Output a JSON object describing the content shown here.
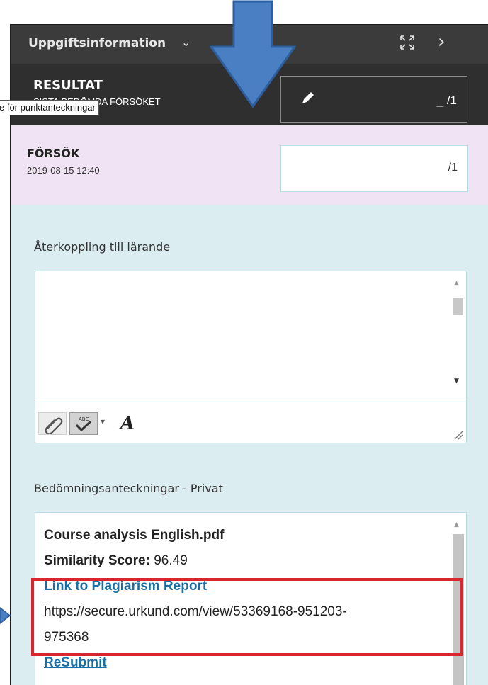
{
  "header": {
    "title": "Uppgiftsinformation",
    "dropdown_icon": "chevron-down-icon",
    "expand_icon": "expand-icon",
    "next_icon": "chevron-right-icon"
  },
  "result": {
    "label": "RESULTAT",
    "sublabel": "SISTA BEDÖMDA FÖRSÖKET",
    "score_value": "_",
    "score_max": "/1",
    "edit_icon": "pencil-icon"
  },
  "tooltip": "e för punktanteckningar",
  "attempt": {
    "label": "FÖRSÖK",
    "date": "2019-08-15 12:40",
    "score_max": "/1"
  },
  "feedback": {
    "label": "Återkoppling till lärande",
    "toolbar": {
      "attach_icon": "paperclip-icon",
      "spellcheck_icon": "spellcheck-icon",
      "font_icon": "font-italic-a-icon",
      "font_label": "A"
    }
  },
  "grading_notes": {
    "label": "Bedömningsanteckningar - Privat",
    "file_name": "Course analysis English.pdf",
    "similarity_label": "Similarity Score:",
    "similarity_value": "96.49",
    "report_link": "Link to Plagiarism Report ",
    "report_url_line1": "https://secure.urkund.com/view/53369168-951203-",
    "report_url_line2": "975368",
    "resubmit_link": "ReSubmit "
  },
  "colors": {
    "header_bg": "#3b3b3b",
    "result_bg": "#2f2f2f",
    "attempt_bg": "#f0e3f3",
    "panel_bg": "#dcedf2",
    "link": "#1a6ea3",
    "highlight": "#d9262e",
    "arrow": "#4a7fc4"
  }
}
